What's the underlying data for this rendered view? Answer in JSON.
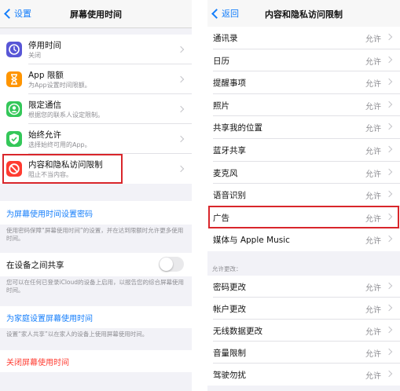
{
  "left": {
    "nav": {
      "back_label": "设置",
      "title": "屏幕使用时间"
    },
    "items": [
      {
        "title": "停用时间",
        "subtitle": "关闭",
        "icon": "downtime-icon",
        "color": "#5856d6"
      },
      {
        "title": "App 限额",
        "subtitle": "为App设置时间限额。",
        "icon": "hourglass-icon",
        "color": "#ff9500"
      },
      {
        "title": "限定通信",
        "subtitle": "根据您的联系人设定限制。",
        "icon": "contacts-icon",
        "color": "#34c759"
      },
      {
        "title": "始终允许",
        "subtitle": "选择始终可用的App。",
        "icon": "checkmark-icon",
        "color": "#34c759"
      },
      {
        "title": "内容和隐私访问限制",
        "subtitle": "阻止不当内容。",
        "icon": "restriction-icon",
        "color": "#ff3b30"
      }
    ],
    "passcode": {
      "label": "为屏幕使用时间设置密码",
      "desc": "使用密码保障“屏幕使用时间”的设置，并在达到限额时允许更多使用时间。"
    },
    "share": {
      "label": "在设备之间共享",
      "toggle_on": false,
      "desc": "您可以在任何已登录iCloud的设备上启用，以报告您的综合屏幕使用时间。"
    },
    "family": {
      "label": "为家庭设置屏幕使用时间",
      "desc": "设置“家人共享”以在家人的设备上使用屏幕使用时间。"
    },
    "turn_off": {
      "label": "关闭屏幕使用时间"
    }
  },
  "right": {
    "nav": {
      "back_label": "返回",
      "title": "内容和隐私访问限制"
    },
    "items": [
      {
        "label": "通讯录",
        "value": "允许"
      },
      {
        "label": "日历",
        "value": "允许"
      },
      {
        "label": "提醒事项",
        "value": "允许"
      },
      {
        "label": "照片",
        "value": "允许"
      },
      {
        "label": "共享我的位置",
        "value": "允许"
      },
      {
        "label": "蓝牙共享",
        "value": "允许"
      },
      {
        "label": "麦克风",
        "value": "允许"
      },
      {
        "label": "语音识别",
        "value": "允许"
      },
      {
        "label": "广告",
        "value": "允许"
      },
      {
        "label": "媒体与 Apple Music",
        "value": "允许"
      }
    ],
    "section_header": "允许更改：",
    "change_items": [
      {
        "label": "密码更改",
        "value": "允许"
      },
      {
        "label": "帐户更改",
        "value": "允许"
      },
      {
        "label": "无线数据更改",
        "value": "允许"
      },
      {
        "label": "音量限制",
        "value": "允许"
      },
      {
        "label": "驾驶勿扰",
        "value": "允许"
      }
    ]
  },
  "colors": {
    "accent": "#147efb",
    "highlight": "#d9262b",
    "destructive": "#ff3b30"
  }
}
